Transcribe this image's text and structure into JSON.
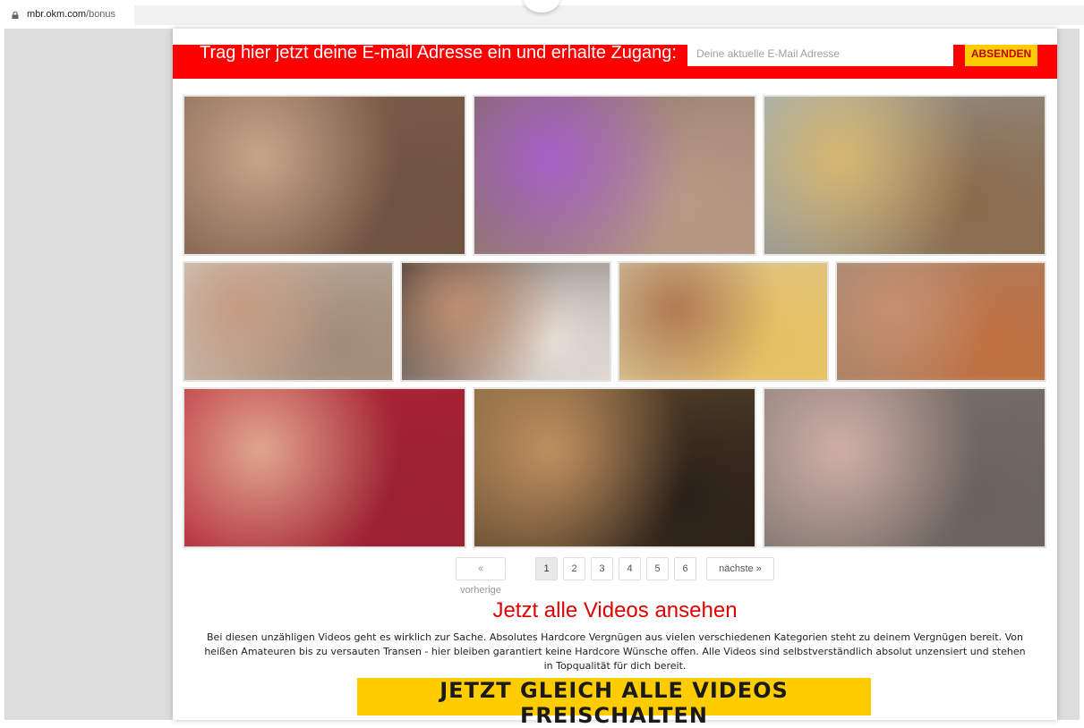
{
  "browser": {
    "url_host": "mbr.okm.com",
    "url_path": "/bonus"
  },
  "email_bar": {
    "headline": "Trag hier jetzt deine E-mail Adresse ein und erhalte Zugang:",
    "input_placeholder": "Deine aktuelle E-Mail Adresse",
    "submit_label": "ABSENDEN"
  },
  "gallery": {
    "rows": [
      {
        "thumbs": [
          {
            "colors": [
              "#8a6a55",
              "#c9a58a",
              "#6e5240"
            ]
          },
          {
            "colors": [
              "#7a6658",
              "#a660c8",
              "#b89a86"
            ]
          },
          {
            "colors": [
              "#9ab4c8",
              "#d8b870",
              "#8a6a4a"
            ]
          }
        ]
      },
      {
        "thumbs": [
          {
            "colors": [
              "#d8cfc4",
              "#c49a80",
              "#a08a78"
            ]
          },
          {
            "colors": [
              "#2a2220",
              "#c09070",
              "#e8e0d8"
            ]
          },
          {
            "colors": [
              "#cfc8b0",
              "#b07850",
              "#e8c060"
            ]
          },
          {
            "colors": [
              "#9a8a78",
              "#c89070",
              "#c07040"
            ]
          }
        ]
      },
      {
        "thumbs": [
          {
            "colors": [
              "#c0283a",
              "#e0a890",
              "#9a2030"
            ]
          },
          {
            "colors": [
              "#8a6a40",
              "#c09060",
              "#2a2018"
            ]
          },
          {
            "colors": [
              "#8a8078",
              "#d0b0a8",
              "#6a625c"
            ]
          }
        ]
      }
    ]
  },
  "pagination": {
    "prev_label": "« vorherige",
    "pages": [
      "1",
      "2",
      "3",
      "4",
      "5",
      "6"
    ],
    "active_page": "1",
    "next_label": "nächste »"
  },
  "cta": {
    "title": "Jetzt alle Videos ansehen",
    "text": "Bei diesen unzähligen Videos geht es wirklich zur Sache. Absolutes Hardcore Vergnügen aus vielen verschiedenen Kategorien steht zu deinem Vergnügen bereit. Von heißen Amateuren bis zu versauten Transen - hier bleiben garantiert keine Hardcore Wünsche offen. Alle Videos sind selbstverständlich absolut unzensiert und stehen in Topqualität für dich bereit.",
    "button_label": "JETZT GLEICH ALLE VIDEOS FREISCHALTEN"
  },
  "colors": {
    "accent_red": "#ff0000",
    "button_yellow": "#ffcc00",
    "page_gray": "#dddddd"
  }
}
